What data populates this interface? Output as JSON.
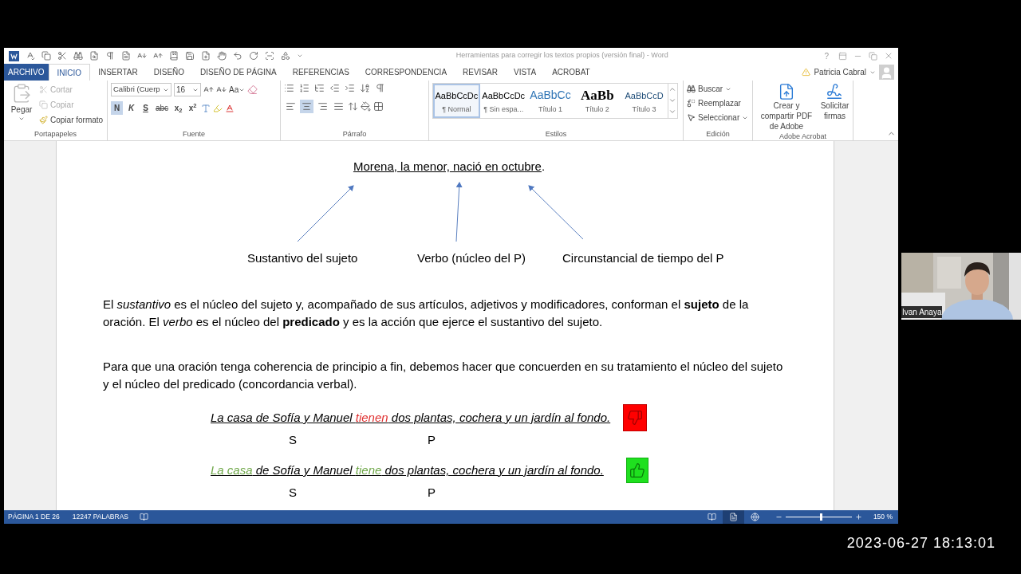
{
  "window": {
    "title": "Herramientas para corregir los textos propios (versión final) - Word",
    "help": "?"
  },
  "tabs": [
    {
      "label": "ARCHIVO",
      "kind": "file",
      "selected": false
    },
    {
      "label": "INICIO",
      "kind": "tab",
      "selected": true
    },
    {
      "label": "INSERTAR",
      "kind": "tab",
      "selected": false
    },
    {
      "label": "DISEÑO",
      "kind": "tab",
      "selected": false
    },
    {
      "label": "DISEÑO DE PÁGINA",
      "kind": "tab",
      "selected": false
    },
    {
      "label": "REFERENCIAS",
      "kind": "tab",
      "selected": false
    },
    {
      "label": "CORRESPONDENCIA",
      "kind": "tab",
      "selected": false
    },
    {
      "label": "REVISAR",
      "kind": "tab",
      "selected": false
    },
    {
      "label": "VISTA",
      "kind": "tab",
      "selected": false
    },
    {
      "label": "ACROBAT",
      "kind": "tab",
      "selected": false
    }
  ],
  "user": {
    "name": "Patricia Cabral"
  },
  "ribbon": {
    "clipboard": {
      "label": "Portapapeles",
      "paste": "Pegar",
      "items": [
        {
          "label": "Cortar",
          "disabled": true
        },
        {
          "label": "Copiar",
          "disabled": true
        },
        {
          "label": "Copiar formato",
          "disabled": false
        }
      ]
    },
    "font": {
      "label": "Fuente",
      "font_name": "Calibri (Cuerp",
      "font_size": "16",
      "change_case": "Aa",
      "format_buttons": [
        {
          "label": "N",
          "kind": "bold",
          "selected": true
        },
        {
          "label": "K",
          "kind": "italic",
          "selected": false
        },
        {
          "label": "S",
          "kind": "underline",
          "selected": false
        },
        {
          "label": "abc",
          "kind": "strike",
          "selected": false
        },
        {
          "label": "x$_{2}$",
          "kind": "sub",
          "selected": false
        },
        {
          "label": "x$^{2}$",
          "kind": "sup",
          "selected": false
        }
      ]
    },
    "paragraph": {
      "label": "Párrafo",
      "alignments": [
        {
          "kind": "left",
          "selected": false
        },
        {
          "kind": "center",
          "selected": true
        },
        {
          "kind": "right",
          "selected": false
        },
        {
          "kind": "justify",
          "selected": false
        }
      ]
    },
    "styles": {
      "label": "Estilos",
      "items": [
        {
          "preview": "AaBbCcDc",
          "name": "¶ Normal",
          "kind": "normal",
          "selected": true
        },
        {
          "preview": "AaBbCcDc",
          "name": "¶ Sin espa...",
          "kind": "normal",
          "selected": false
        },
        {
          "preview": "AaBbCc",
          "name": "Título 1",
          "kind": "heading1",
          "selected": false
        },
        {
          "preview": "AaBb",
          "name": "Título 2",
          "kind": "heading2",
          "selected": false
        },
        {
          "preview": "AaBbCcD",
          "name": "Título 3",
          "kind": "heading3",
          "selected": false
        }
      ]
    },
    "editing": {
      "label": "Edición",
      "find": "Buscar",
      "replace": "Reemplazar",
      "select": "Seleccionar"
    },
    "acrobat": {
      "label": "Adobe Acrobat",
      "create": "Crear y compartir PDF de Adobe",
      "sign": "Solicitar firmas"
    }
  },
  "document": {
    "sentence": [
      {
        "text": "Morena, la menor,",
        "underlined": true
      },
      {
        "text": " nació en octubre",
        "underlined": true
      },
      {
        "text": ".",
        "underlined": false
      }
    ],
    "annotations": [
      "Sustantivo del sujeto",
      "Verbo (núcleo del P)",
      "Circunstancial de tiempo del P"
    ],
    "paragraphs": [
      "El *sustantivo* es el núcleo del sujeto y, acompañado de sus artículos, adjetivos y modificadores, conforman el **sujeto** de la oración. El *verbo* es el núcleo del **predicado** y es la acción que ejerce el sustantivo del sujeto.",
      "Para que una oración tenga coherencia de principio a fin, debemos hacer que concuerden en su tratamiento el núcleo del sujeto y el núcleo del predicado (concordancia verbal)."
    ],
    "examples": [
      {
        "segments": [
          {
            "text": "La casa de Sofía y Manuel ",
            "color": "#000000"
          },
          {
            "text": "tienen",
            "color": "#e03131"
          },
          {
            "text": " dos plantas, cochera y un jardín al fondo.",
            "color": "#000000"
          }
        ],
        "kind": "wrong",
        "subject_label": "S",
        "predicate_label": "P"
      },
      {
        "segments": [
          {
            "text": "La casa",
            "color": "#70a84a"
          },
          {
            "text": " de Sofía y Manuel ",
            "color": "#000000"
          },
          {
            "text": "tiene",
            "color": "#70a84a"
          },
          {
            "text": " dos plantas, cochera y un jardín al fondo.",
            "color": "#000000"
          }
        ],
        "kind": "right",
        "subject_label": "S",
        "predicate_label": "P"
      }
    ]
  },
  "status_bar": {
    "page": "PÁGINA 1 DE 26",
    "words": "12247 PALABRAS",
    "views": [
      {
        "kind": "read",
        "selected": false
      },
      {
        "kind": "print",
        "selected": true
      },
      {
        "kind": "web",
        "selected": false
      }
    ],
    "zoom": {
      "level": 0.53,
      "label": "150 %"
    }
  },
  "video": {
    "name": "Ivan Anaya"
  },
  "timestamp": "2023-06-27 18:13:01"
}
